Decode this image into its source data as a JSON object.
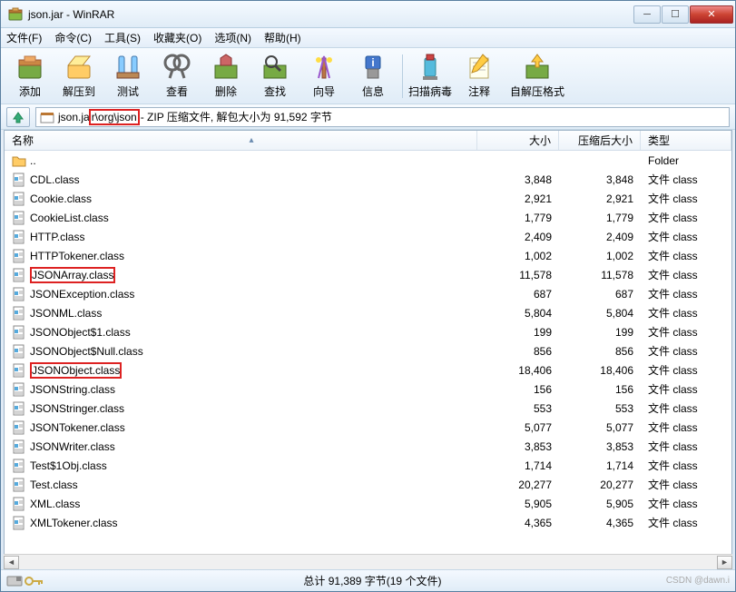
{
  "window": {
    "title": "json.jar - WinRAR",
    "min_label": "─",
    "max_label": "☐",
    "close_label": "✕"
  },
  "menu": {
    "file": "文件(F)",
    "commands": "命令(C)",
    "tools": "工具(S)",
    "favorites": "收藏夹(O)",
    "options": "选项(N)",
    "help": "帮助(H)"
  },
  "toolbar": {
    "add": "添加",
    "extract": "解压到",
    "test": "测试",
    "view": "查看",
    "delete": "删除",
    "find": "查找",
    "wizard": "向导",
    "info": "信息",
    "scan": "扫描病毒",
    "comment": "注释",
    "sfx": "自解压格式"
  },
  "path": {
    "prefix": "json.ja",
    "highlighted": "r\\org\\json",
    "suffix": " - ZIP 压缩文件, 解包大小为 91,592 字节"
  },
  "columns": {
    "name": "名称",
    "size": "大小",
    "packed": "压缩后大小",
    "type": "类型"
  },
  "parent_row": {
    "name": "..",
    "type": "Folder"
  },
  "files": [
    {
      "name": "CDL.class",
      "size": "3,848",
      "packed": "3,848",
      "type": "文件 class",
      "hl": false
    },
    {
      "name": "Cookie.class",
      "size": "2,921",
      "packed": "2,921",
      "type": "文件 class",
      "hl": false
    },
    {
      "name": "CookieList.class",
      "size": "1,779",
      "packed": "1,779",
      "type": "文件 class",
      "hl": false
    },
    {
      "name": "HTTP.class",
      "size": "2,409",
      "packed": "2,409",
      "type": "文件 class",
      "hl": false
    },
    {
      "name": "HTTPTokener.class",
      "size": "1,002",
      "packed": "1,002",
      "type": "文件 class",
      "hl": false
    },
    {
      "name": "JSONArray.class",
      "size": "11,578",
      "packed": "11,578",
      "type": "文件 class",
      "hl": true
    },
    {
      "name": "JSONException.class",
      "size": "687",
      "packed": "687",
      "type": "文件 class",
      "hl": false
    },
    {
      "name": "JSONML.class",
      "size": "5,804",
      "packed": "5,804",
      "type": "文件 class",
      "hl": false
    },
    {
      "name": "JSONObject$1.class",
      "size": "199",
      "packed": "199",
      "type": "文件 class",
      "hl": false
    },
    {
      "name": "JSONObject$Null.class",
      "size": "856",
      "packed": "856",
      "type": "文件 class",
      "hl": false
    },
    {
      "name": "JSONObject.class",
      "size": "18,406",
      "packed": "18,406",
      "type": "文件 class",
      "hl": true
    },
    {
      "name": "JSONString.class",
      "size": "156",
      "packed": "156",
      "type": "文件 class",
      "hl": false
    },
    {
      "name": "JSONStringer.class",
      "size": "553",
      "packed": "553",
      "type": "文件 class",
      "hl": false
    },
    {
      "name": "JSONTokener.class",
      "size": "5,077",
      "packed": "5,077",
      "type": "文件 class",
      "hl": false
    },
    {
      "name": "JSONWriter.class",
      "size": "3,853",
      "packed": "3,853",
      "type": "文件 class",
      "hl": false
    },
    {
      "name": "Test$1Obj.class",
      "size": "1,714",
      "packed": "1,714",
      "type": "文件 class",
      "hl": false
    },
    {
      "name": "Test.class",
      "size": "20,277",
      "packed": "20,277",
      "type": "文件 class",
      "hl": false
    },
    {
      "name": "XML.class",
      "size": "5,905",
      "packed": "5,905",
      "type": "文件 class",
      "hl": false
    },
    {
      "name": "XMLTokener.class",
      "size": "4,365",
      "packed": "4,365",
      "type": "文件 class",
      "hl": false
    }
  ],
  "status": {
    "center": "总计 91,389 字节(19 个文件)",
    "right": "CSDN @dawn.i"
  }
}
